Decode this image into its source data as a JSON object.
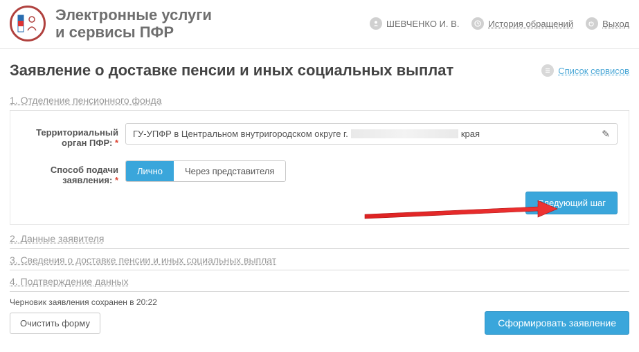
{
  "header": {
    "brand_line1": "Электронные услуги",
    "brand_line2": "и сервисы ПФР",
    "user_name": "ШЕВЧЕНКО И. В.",
    "history_label": "История обращений",
    "logout_label": "Выход"
  },
  "page": {
    "title": "Заявление о доставке пенсии и иных социальных выплат",
    "services_link": "Список сервисов"
  },
  "steps": {
    "s1": "1. Отделение пенсионного фонда",
    "s2": "2. Данные заявителя",
    "s3": "3. Сведения о доставке пенсии и иных социальных выплат",
    "s4": "4. Подтверждение данных"
  },
  "form": {
    "territorial_label": "Территориальный орган ПФР:",
    "territorial_value_prefix": "ГУ-УПФР в Центральном внутригородском округе г.",
    "territorial_value_suffix": "края",
    "method_label": "Способ подачи заявления:",
    "method_option_self": "Лично",
    "method_option_rep": "Через представителя",
    "next_label": "Следующий шаг"
  },
  "footer": {
    "draft_saved": "Черновик заявления сохранен в 20:22",
    "clear_label": "Очистить форму",
    "submit_label": "Сформировать заявление"
  }
}
